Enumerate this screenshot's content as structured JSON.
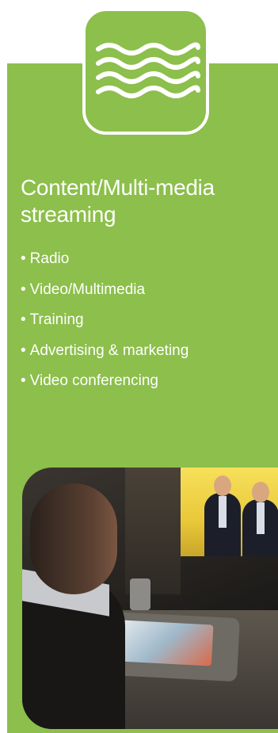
{
  "title_line1": "Content/Multi-media",
  "title_line2": "streaming",
  "bullet_char": "•",
  "items": [
    {
      "label": "Radio"
    },
    {
      "label": "Video/Multimedia"
    },
    {
      "label": "Training"
    },
    {
      "label": "Advertising & marketing"
    },
    {
      "label": "Video conferencing"
    }
  ],
  "icons": {
    "top_tile": "waves-icon"
  },
  "colors": {
    "panel_green": "#8cbf4b",
    "text": "#ffffff"
  }
}
